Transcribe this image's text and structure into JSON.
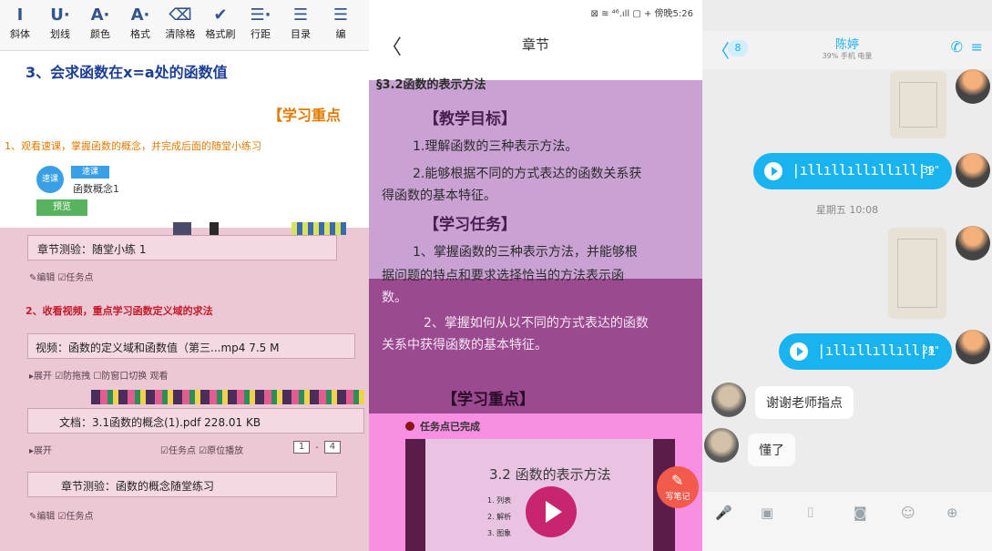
{
  "left": {
    "toolbar": [
      "斜体",
      "划线",
      "颜色",
      "格式",
      "清除格",
      "格式刷",
      "行距",
      "目录",
      "编"
    ],
    "toolbar_icons": [
      "I",
      "U·",
      "A·",
      "A·",
      "⌫",
      "✔",
      "☰·",
      "☰",
      "☰"
    ],
    "heading": "3、会求函数在x=a处的函数值",
    "section": "【学习重点",
    "task1": "1、观看速课，掌握函数的概念，并完成后面的随堂小练习",
    "chip": "速课",
    "chip_tag": "速课",
    "chip_title": "函数概念1",
    "preview_btn": "预览",
    "quiz1": "章节测验：随堂小练 1",
    "edit1": "✎编辑 ☑任务点",
    "task2": "2、收看视频，重点学习函数定义域的求法",
    "video": "视频：函数的定义域和函数值（第三...mp4 7.5 M",
    "video_opts": "▸展开 ☑防拖拽 ☐防窗口切换 观看",
    "doc": "文档：3.1函数的概念(1).pdf 228.01 KB",
    "doc_opts": "▸展开",
    "doc_task": "☑任务点 ☑原位播放",
    "page_from": "1",
    "page_to": "4",
    "quiz2": "章节测验：函数的概念随堂练习",
    "edit2": "✎编辑 ☑任务点"
  },
  "middle": {
    "status": "⊠ ≋ ⁴⁶.ıll ▢ + 傍晚5:26",
    "back": "〈",
    "title": "章节",
    "lesson": "§3.2函数的表示方法",
    "goal_h": "【教学目标】",
    "goal1": "1.理解函数的三种表示方法。",
    "goal2a": "2.能够根据不同的方式表达的函数关系获",
    "goal2b": "得函数的基本特征。",
    "task_h": "【学习任务】",
    "task1a": "1、掌握函数的三种表示方法，并能够根",
    "task1b": "据问题的特点和要求选择恰当的方法表示函",
    "task1c": "数。",
    "task2a": "2、掌握如何从以不同的方式表达的函数",
    "task2b": "关系中获得函数的基本特征。",
    "key_h": "【学习重点】",
    "done": "任务点已完成",
    "video_title": "3.2 函数的表示方法",
    "video_items": [
      "1. 列表",
      "2. 解析",
      "3. 图象"
    ],
    "note_btn": "写笔记"
  },
  "right": {
    "back": "〈",
    "unread": "8",
    "name": "陈婷",
    "sub": "39% 手机 电量",
    "voice1_wave": "|ıllıllıllıllıll|ı",
    "voice1_dur": "39\"",
    "time": "星期五 10:08",
    "voice2_wave": "|ıllıllıllıll|ı",
    "voice2_dur": "28\"",
    "msg1": "谢谢老师指点",
    "msg2": "懂了",
    "bar_icons": [
      "🎤",
      "▣",
      "⌷",
      "◙",
      "☺",
      "⊕"
    ],
    "accent": "#19b4ef"
  }
}
